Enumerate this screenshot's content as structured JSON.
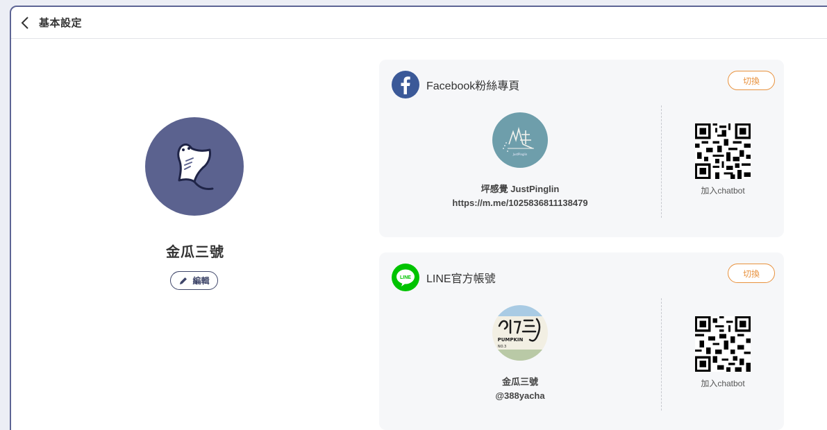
{
  "header": {
    "title": "基本設定"
  },
  "profile": {
    "name": "金瓜三號",
    "edit_label": "編輯"
  },
  "facebook": {
    "title": "Facebook粉絲專頁",
    "switch_label": "切換",
    "page_name": "坪感覺 JustPinglin",
    "page_url": "https://m.me/1025836811138479",
    "qr_label": "加入chatbot",
    "avatar_caption": "JustPinglin"
  },
  "line": {
    "title": "LINE官方帳號",
    "switch_label": "切換",
    "page_name": "金瓜三號",
    "page_id": "@388yacha",
    "qr_label": "加入chatbot",
    "avatar_text": "PUMPKIN",
    "avatar_subtext": "NO.3"
  },
  "colors": {
    "primary": "#5b628f",
    "accent": "#e8913c",
    "facebook": "#3b5998",
    "line": "#00c300"
  }
}
